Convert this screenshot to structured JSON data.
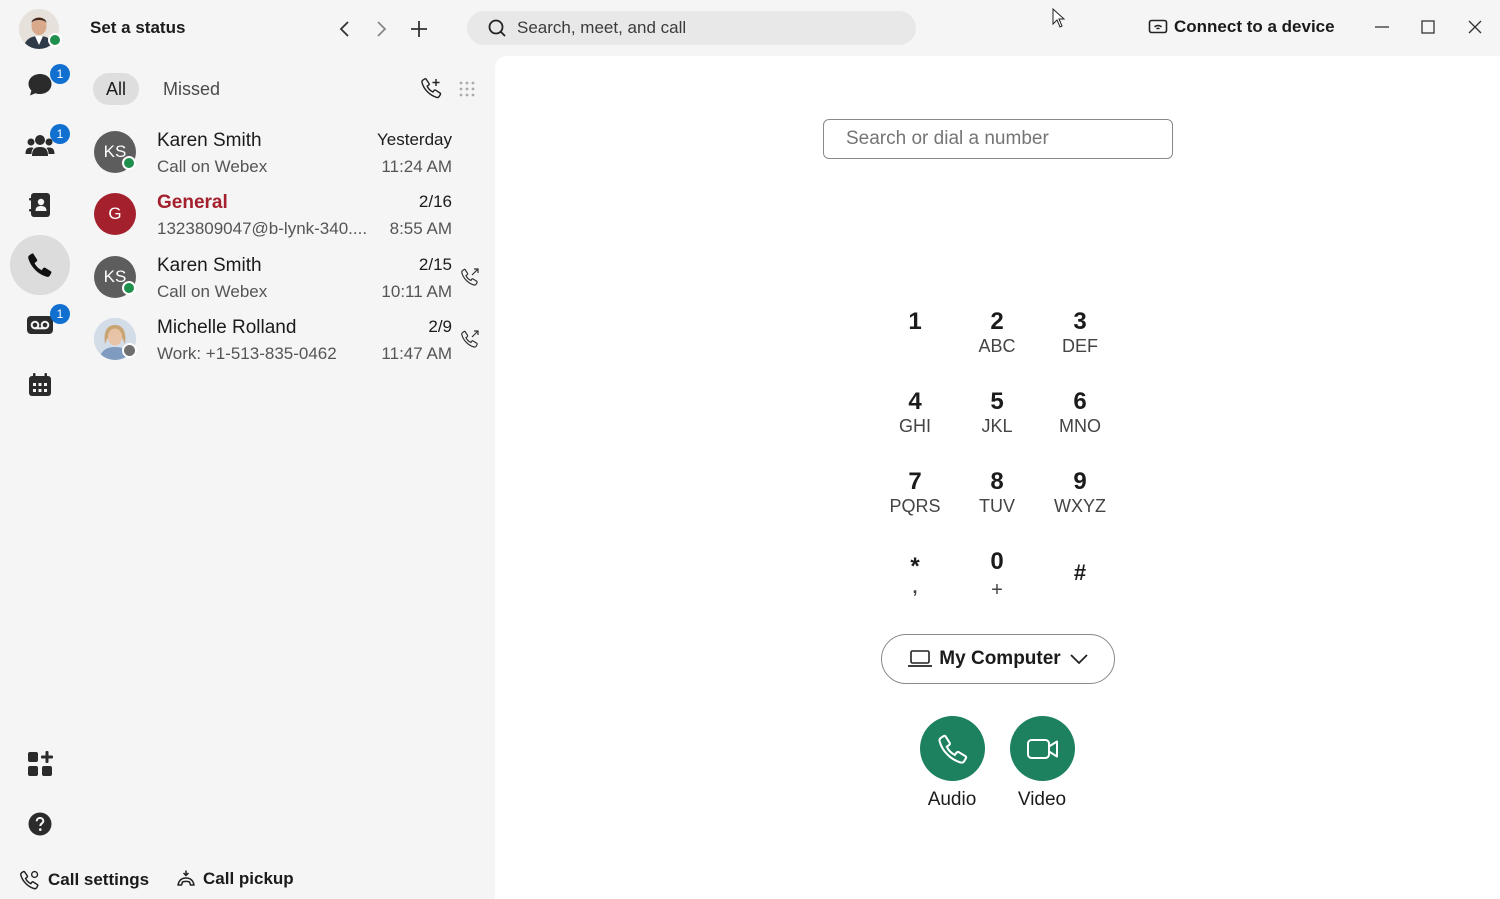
{
  "header": {
    "status_label": "Set a status",
    "search_placeholder": "Search, meet, and call",
    "connect_label": "Connect to a device"
  },
  "rail": {
    "messaging_badge": "1",
    "teams_badge": "1",
    "voicemail_badge": "1"
  },
  "filters": {
    "all": "All",
    "missed": "Missed"
  },
  "calls": [
    {
      "initials": "KS",
      "name": "Karen Smith",
      "sub": "Call on Webex",
      "date": "Yesterday",
      "time": "11:24 AM",
      "missed": false
    },
    {
      "initials": "G",
      "name": "General",
      "sub": "1323809047@b-lynk-340....",
      "date": "2/16",
      "time": "8:55 AM",
      "missed": true
    },
    {
      "initials": "KS",
      "name": "Karen Smith",
      "sub": "Call on Webex",
      "date": "2/15",
      "time": "10:11 AM",
      "missed": false
    },
    {
      "initials": "",
      "name": "Michelle Rolland",
      "sub": "Work: +1-513-835-0462",
      "date": "2/9",
      "time": "11:47 AM",
      "missed": false
    }
  ],
  "dialpad": {
    "placeholder": "Search or dial a number",
    "keys": [
      {
        "digit": "1",
        "letters": ""
      },
      {
        "digit": "2",
        "letters": "ABC"
      },
      {
        "digit": "3",
        "letters": "DEF"
      },
      {
        "digit": "4",
        "letters": "GHI"
      },
      {
        "digit": "5",
        "letters": "JKL"
      },
      {
        "digit": "6",
        "letters": "MNO"
      },
      {
        "digit": "7",
        "letters": "PQRS"
      },
      {
        "digit": "8",
        "letters": "TUV"
      },
      {
        "digit": "9",
        "letters": "WXYZ"
      },
      {
        "digit": "*",
        "letters": ","
      },
      {
        "digit": "0",
        "letters": "+"
      },
      {
        "digit": "#",
        "letters": ""
      }
    ],
    "device_label": "My Computer",
    "audio_label": "Audio",
    "video_label": "Video"
  },
  "footer": {
    "call_settings": "Call settings",
    "call_pickup": "Call pickup"
  },
  "colors": {
    "accent_green": "#1d8160",
    "badge_blue": "#1170cf",
    "missed_red": "#a4202c",
    "presence_green": "#1f8f4e"
  }
}
